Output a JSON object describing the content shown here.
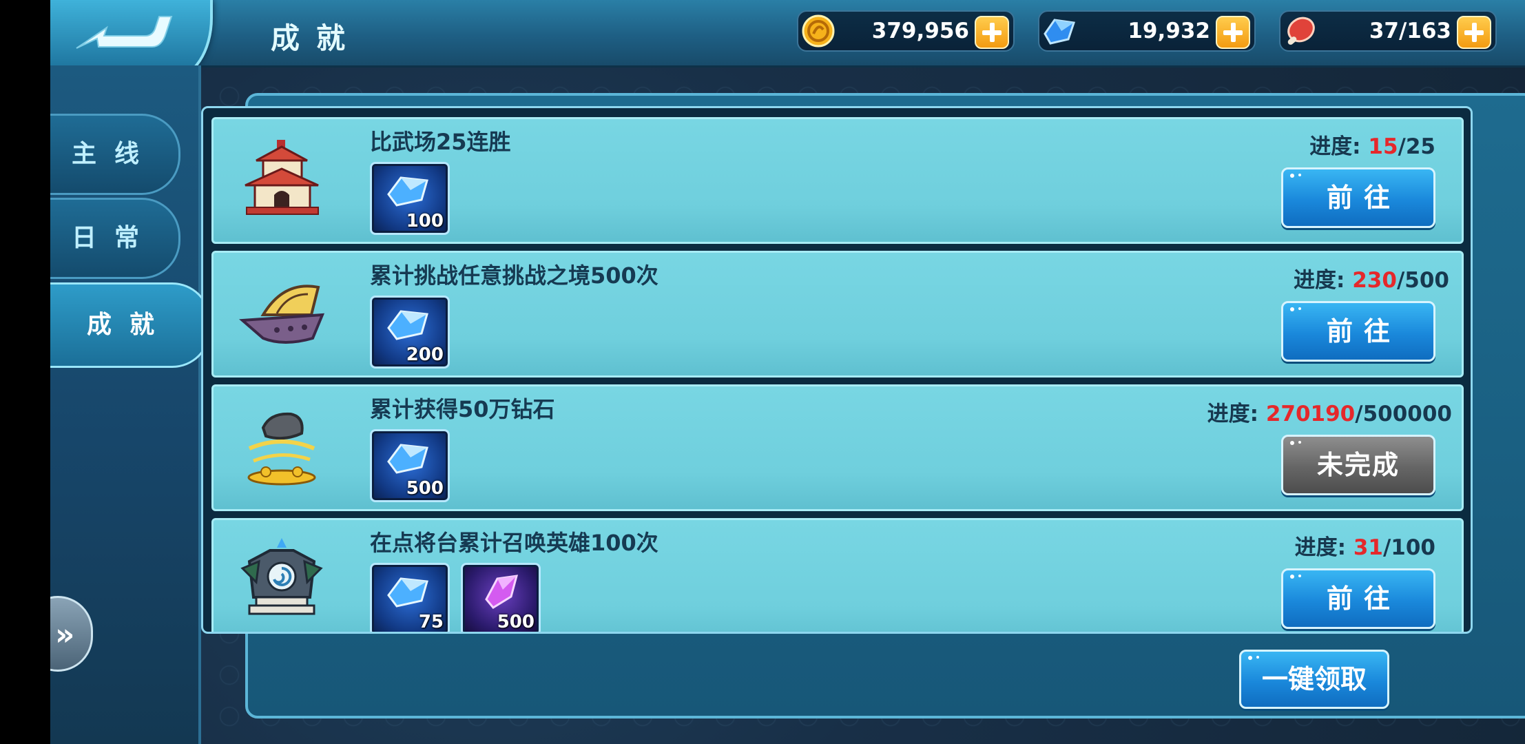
{
  "header": {
    "title": "成就",
    "resources": [
      {
        "name": "gold",
        "icon": "gold-coin-icon",
        "value": "379,956"
      },
      {
        "name": "diamond",
        "icon": "diamond-icon",
        "value": "19,932"
      },
      {
        "name": "stamina",
        "icon": "meat-icon",
        "value": "37/163"
      }
    ]
  },
  "sidebar": {
    "tabs": [
      {
        "label": "主线"
      },
      {
        "label": "日常"
      },
      {
        "label": "成就"
      }
    ]
  },
  "achievements": [
    {
      "name": "比武场25连胜",
      "emblem": "arena-pavilion-icon",
      "progress_label": "进度:",
      "current": "15",
      "total": "/25",
      "rewards": [
        {
          "icon": "diamond-icon",
          "count": "100"
        }
      ],
      "button": "前往"
    },
    {
      "name": "累计挑战任意挑战之境500次",
      "emblem": "dragon-boat-icon",
      "progress_label": "进度:",
      "current": "230",
      "total": "/500",
      "rewards": [
        {
          "icon": "diamond-icon",
          "count": "200"
        }
      ],
      "button": "前往"
    },
    {
      "name": "累计获得50万钻石",
      "emblem": "treasure-pile-icon",
      "progress_label": "进度:",
      "current": "270190",
      "total": "/500000",
      "rewards": [
        {
          "icon": "diamond-icon",
          "count": "500"
        }
      ],
      "button": "未完成"
    },
    {
      "name": "在点将台累计召唤英雄100次",
      "emblem": "summon-altar-icon",
      "progress_label": "进度:",
      "current": "31",
      "total": "/100",
      "rewards": [
        {
          "icon": "diamond-icon",
          "count": "75"
        },
        {
          "icon": "purple-crystal-icon",
          "count": "500"
        }
      ],
      "button": "前往"
    }
  ],
  "footer": {
    "claim_all": "一键领取"
  },
  "colors": {
    "progress_current": "#e5282b",
    "button_blue": "#1a88db",
    "button_gray": "#656565",
    "row_bg": "#72d2df"
  }
}
